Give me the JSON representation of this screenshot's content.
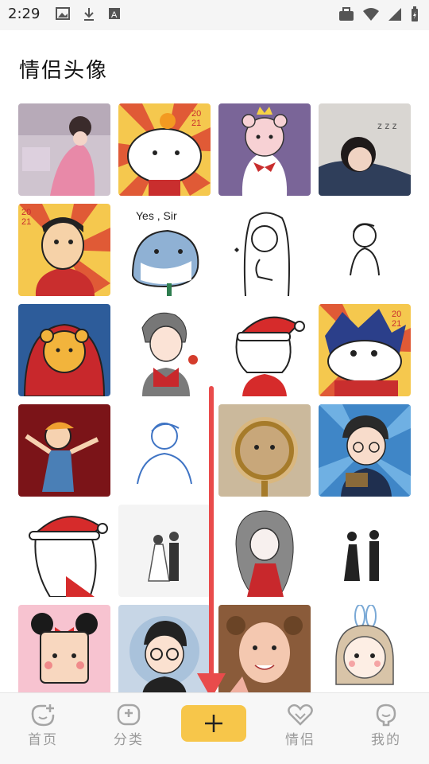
{
  "status_bar": {
    "time": "2:29",
    "left_icons": [
      "image-icon",
      "download-icon",
      "font-icon"
    ],
    "right_icons": [
      "briefcase-icon",
      "wifi-icon",
      "signal-icon",
      "battery-icon"
    ]
  },
  "page": {
    "title": "情侣头像"
  },
  "grid": {
    "tiles": [
      {
        "name": "avatar-girl-pink-room"
      },
      {
        "name": "avatar-bear-cartoon-2021"
      },
      {
        "name": "avatar-bear-crown-purple"
      },
      {
        "name": "avatar-sleeping-girl"
      },
      {
        "name": "avatar-shinchan-dad-2021"
      },
      {
        "name": "avatar-yes-sir-shark"
      },
      {
        "name": "avatar-sketch-girl"
      },
      {
        "name": "avatar-sketch-boy"
      },
      {
        "name": "avatar-bear-red-blue"
      },
      {
        "name": "avatar-boy-flower"
      },
      {
        "name": "avatar-santa-girl"
      },
      {
        "name": "avatar-shinchan-2021"
      },
      {
        "name": "avatar-dancing-kid"
      },
      {
        "name": "avatar-blue-line-boy"
      },
      {
        "name": "avatar-cat-magnifier"
      },
      {
        "name": "avatar-boy-gift"
      },
      {
        "name": "avatar-santa-girl-2"
      },
      {
        "name": "avatar-wedding-couple"
      },
      {
        "name": "avatar-gray-hair-girl"
      },
      {
        "name": "avatar-couple-standing"
      },
      {
        "name": "avatar-pixel-girl"
      },
      {
        "name": "avatar-glasses-boy"
      },
      {
        "name": "avatar-real-kid"
      },
      {
        "name": "avatar-bunny-girl"
      }
    ]
  },
  "bottom_nav": {
    "items": [
      {
        "label": "首页",
        "icon": "home-icon"
      },
      {
        "label": "分类",
        "icon": "category-icon"
      },
      {
        "label": "情侣",
        "icon": "couple-heart-icon"
      },
      {
        "label": "我的",
        "icon": "profile-icon"
      }
    ],
    "add_icon": "plus-icon",
    "accent_color": "#f7c64a"
  },
  "colors": {
    "arrow": "#e94b4b",
    "nav_text": "#9a9a9a"
  }
}
